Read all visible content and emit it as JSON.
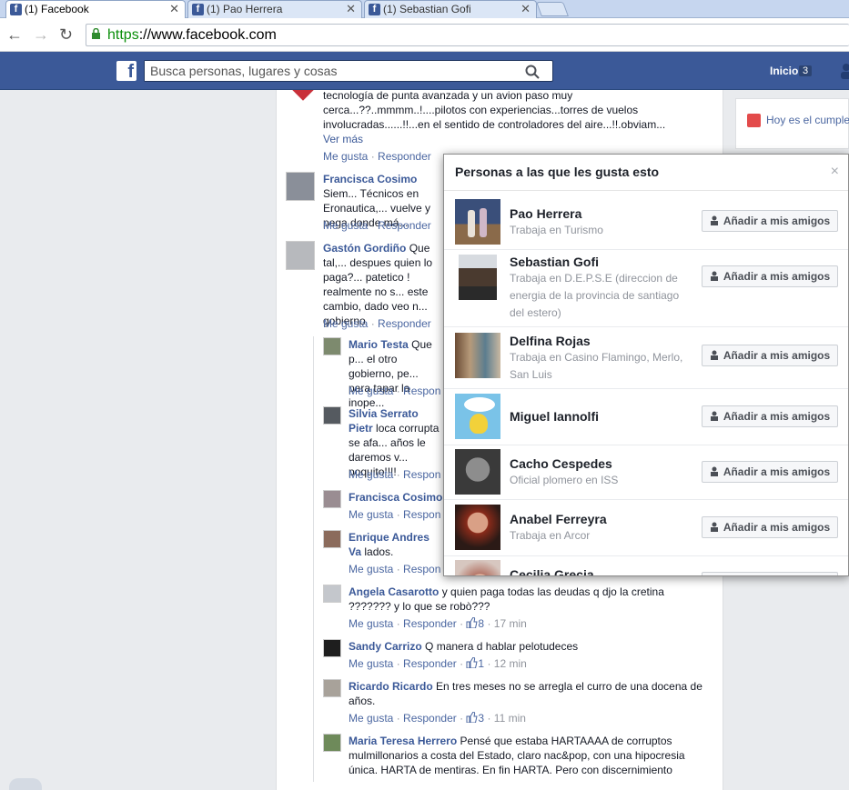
{
  "browser": {
    "tabs": [
      {
        "label": "(1) Facebook",
        "active": true
      },
      {
        "label": "(1) Pao Herrera",
        "active": false
      },
      {
        "label": "(1) Sebastian Gofi",
        "active": false
      }
    ],
    "url_scheme": "https",
    "url_rest": "://www.facebook.com"
  },
  "fb": {
    "logo": "f",
    "search_placeholder": "Busca personas, lugares y cosas",
    "home_label": "Inicio",
    "home_count": "3"
  },
  "feed": {
    "comments": [
      {
        "author": "",
        "text": "tecnología de punta avanzada y un avion paso muy cerca...??..mmmm..!....pilotos con experiencias...torres de vuelos involucradas......!!...en el sentido de controladores del aire...!!.obviam...",
        "more": "Ver más",
        "meta": [
          "Me gusta",
          "Responder"
        ]
      },
      {
        "author": "Francisca Cosimo",
        "text": "Siem... Técnicos en Eronautica,... vuelve y pega donde má...",
        "meta": [
          "Me gusta",
          "Responder"
        ]
      },
      {
        "author": "Gastón Gordiño",
        "text": "Que tal,... despues quien lo paga?... patetico ! realmente no s... este cambio, dado veo n... gobierno",
        "meta": [
          "Me gusta",
          "Responder"
        ]
      },
      {
        "author": "Mario Testa",
        "text": "Que p... el otro gobierno, pe... para tapar la inope...",
        "meta": [
          "Me gusta",
          "Respon"
        ]
      },
      {
        "author": "Silvia Serrato Pietr",
        "text": "loca corrupta se afa... años le daremos v... poquito!!!!",
        "meta": [
          "Me gusta",
          "Respon"
        ]
      },
      {
        "author": "Francisca Cosimo",
        "text": "",
        "meta": [
          "Me gusta",
          "Respon"
        ]
      },
      {
        "author": "Enrique Andres Va",
        "text": "lados.",
        "meta": [
          "Me gusta",
          "Respon"
        ]
      },
      {
        "author": "Angela Casarotto",
        "text": "y quien paga todas las deudas q djo la cretina ??????? y lo que se robò???",
        "meta": [
          "Me gusta",
          "Responder"
        ],
        "likes": "8",
        "time": "17 min"
      },
      {
        "author": "Sandy Carrizo",
        "text": "Q manera d hablar pelotudeces",
        "meta": [
          "Me gusta",
          "Responder"
        ],
        "likes": "1",
        "time": "12 min"
      },
      {
        "author": "Ricardo Ricardo",
        "text": "En tres meses no se arregla el curro de una docena de años.",
        "meta": [
          "Me gusta",
          "Responder"
        ],
        "likes": "3",
        "time": "11 min"
      },
      {
        "author": "Maria Teresa Herrero",
        "text": "Pensé que estaba HARTAAAA de corruptos mulmillonarios a costa del Estado, claro nac&pop, con una hipocresia única. HARTA de mentiras. En fin HARTA. Pero con discernimiento",
        "meta": []
      }
    ]
  },
  "right": {
    "birthday_text": "Hoy es el cumple"
  },
  "modal": {
    "title": "Personas a las que les gusta esto",
    "close": "×",
    "add_label": "Añadir a mis amigos",
    "people": [
      {
        "name": "Pao Herrera",
        "work_prefix": "Trabaja en",
        "work_place": "Turismo"
      },
      {
        "name": "Sebastian Gofi",
        "work_prefix": "Trabaja en",
        "work_place": "D.E.P.S.E (direccion de energia de la provincia de santiago del estero)"
      },
      {
        "name": "Delfina Rojas",
        "work_prefix": "Trabaja en",
        "work_place": "Casino Flamingo, Merlo, San Luis"
      },
      {
        "name": "Miguel Iannolfi",
        "work_prefix": "",
        "work_place": ""
      },
      {
        "name": "Cacho Cespedes",
        "work_prefix": "Oficial plomero en",
        "work_place": "ISS"
      },
      {
        "name": "Anabel Ferreyra",
        "work_prefix": "Trabaja en",
        "work_place": "Arcor"
      },
      {
        "name": "Cecilia Grecia",
        "work_prefix": "",
        "work_place": ""
      }
    ]
  },
  "colors": {
    "fb_blue": "#3b5998",
    "link": "#4b67a1",
    "muted": "#90949c"
  }
}
